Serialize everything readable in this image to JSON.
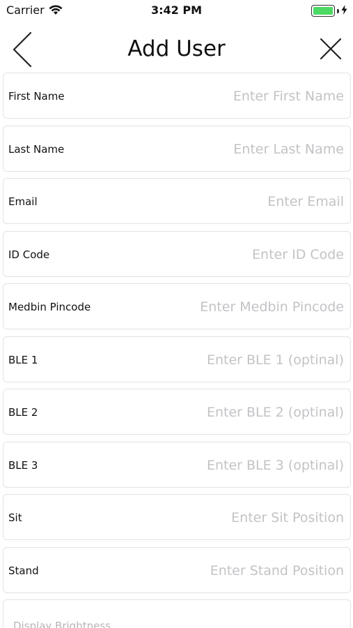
{
  "status_bar": {
    "carrier": "Carrier",
    "time": "3:42 PM",
    "battery_level": 1.0,
    "battery_color": "#4cd964",
    "wifi_icon": "wifi-icon",
    "charging_icon": "bolt-icon"
  },
  "nav": {
    "title": "Add User",
    "back_icon": "chevron-left-icon",
    "close_icon": "close-icon"
  },
  "form": {
    "fields": [
      {
        "label": "First Name",
        "placeholder": "Enter First Name",
        "value": ""
      },
      {
        "label": "Last Name",
        "placeholder": "Enter Last Name",
        "value": ""
      },
      {
        "label": "Email",
        "placeholder": "Enter Email",
        "value": ""
      },
      {
        "label": "ID Code",
        "placeholder": "Enter ID Code",
        "value": ""
      },
      {
        "label": "Medbin Pincode",
        "placeholder": "Enter Medbin Pincode",
        "value": ""
      },
      {
        "label": "BLE 1",
        "placeholder": "Enter BLE 1 (optinal)",
        "value": ""
      },
      {
        "label": "BLE 2",
        "placeholder": "Enter BLE 2 (optinal)",
        "value": ""
      },
      {
        "label": "BLE 3",
        "placeholder": "Enter BLE 3 (optinal)",
        "value": ""
      },
      {
        "label": "Sit",
        "placeholder": "Enter Sit Position",
        "value": ""
      },
      {
        "label": "Stand",
        "placeholder": "Enter Stand Position",
        "value": ""
      }
    ],
    "partial_row_label": "Display Brightness"
  },
  "colors": {
    "placeholder": "#c3c3c7",
    "border": "#e3e3e3",
    "text": "#111111"
  }
}
